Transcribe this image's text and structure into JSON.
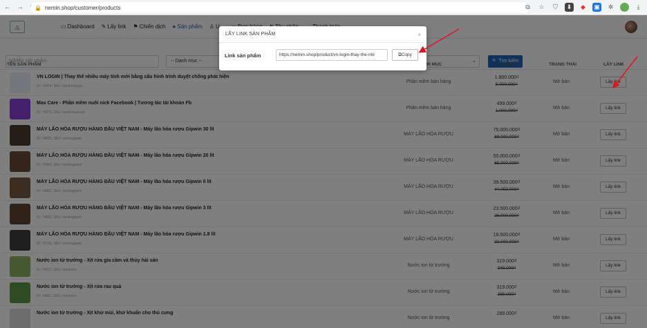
{
  "browser": {
    "url": "nemin.shop/customer/products",
    "nav_back": "←",
    "nav_forward": "→",
    "nav_reload": "C"
  },
  "header": {
    "menu": [
      {
        "label": "Dashboard",
        "icon": "▭",
        "active": false
      },
      {
        "label": "Lấy link",
        "icon": "✎",
        "active": false
      },
      {
        "label": "Chiến dịch",
        "icon": "⚑",
        "active": false
      },
      {
        "label": "Sản phẩm",
        "icon": "●",
        "active": true
      },
      {
        "label": "U...",
        "icon": "♙",
        "active": false
      },
      {
        "label": "Đơn hàng",
        "icon": "▭",
        "active": false
      },
      {
        "label": "Thu nhập",
        "icon": "↯",
        "active": false
      },
      {
        "label": "Thanh toán",
        "icon": "▬",
        "active": false
      }
    ]
  },
  "filters": {
    "search_placeholder": "Mã/tên sản phẩm",
    "category_value": "-- Danh mục --",
    "search_button": "Tìm kiếm",
    "search_icon": "🔍"
  },
  "table": {
    "headers": {
      "name": "TÊN SẢN PHẨM",
      "category": "DANH MỤC",
      "price": "GIÁ BÁN",
      "status": "TRẠNG THÁI",
      "action": "LẤY LINK"
    },
    "rows": [
      {
        "name": "VN LOGIN | Thay thế nhiều máy tính mới bằng cấu hình trình duyệt chống phát hiện",
        "meta": "ID: 74874, SKU: neminvnlogin",
        "category": "Phần mềm bán hàng",
        "price": "1.800.000₫",
        "old_price": "5.000.000₫",
        "status": "Mở bán",
        "button": "Lấy link",
        "thumb": "#e8eef7"
      },
      {
        "name": "Max Care - Phần mềm nuôi nick Facebook | Tương tác tài khoản Fb",
        "meta": "ID: 74875, SKU: neminmaxcare",
        "category": "Phần mềm bán hàng",
        "price": "499.000₫",
        "old_price": "1.000.000₫",
        "status": "Mở bán",
        "button": "Lấy link",
        "thumb": "#8a3fd6"
      },
      {
        "name": "MÁY LÃO HÓA RƯỢU HÀNG ĐẦU VIỆT NAM - Máy lão hóa rượu Gipwin 30 lít",
        "meta": "ID: 74805, SKU: nemingipwin",
        "category": "MÁY LÃO HÓA RƯỢU",
        "price": "75.000.000₫",
        "old_price": "89.000.000₫",
        "status": "Mở bán",
        "button": "Lấy link",
        "thumb": "#4a3a30"
      },
      {
        "name": "MÁY LÃO HÓA RƯỢU HÀNG ĐẦU VIỆT NAM - Máy lão hóa rượu Gipwin 20 lít",
        "meta": "ID: 74804, SKU: nemingipwin",
        "category": "MÁY LÃO HÓA RƯỢU",
        "price": "55.000.000₫",
        "old_price": "65.000.000₫",
        "status": "Mở bán",
        "button": "Lấy link",
        "thumb": "#6b4b35"
      },
      {
        "name": "MÁY LÃO HÓA RƯỢU HÀNG ĐẦU VIỆT NAM - Máy lão hóa rượu Gipwin 5 lít",
        "meta": "ID: 74801, SKU: nemingipwin",
        "category": "MÁY LÃO HÓA RƯỢU",
        "price": "38.500.000₫",
        "old_price": "44.000.000₫",
        "status": "Mở bán",
        "button": "Lấy link",
        "thumb": "#7a5a40"
      },
      {
        "name": "MÁY LÃO HÓA RƯỢU HÀNG ĐẦU VIỆT NAM - Máy lão hóa rượu Gipwin 3 lít",
        "meta": "ID: 74800, SKU: nemingipwin",
        "category": "MÁY LÃO HÓA RƯỢU",
        "price": "23.500.000₫",
        "old_price": "26.000.000₫",
        "status": "Mở bán",
        "button": "Lấy link",
        "thumb": "#5e4530"
      },
      {
        "name": "MÁY LÃO HÓA RƯỢU HÀNG ĐẦU VIỆT NAM - Máy lão hóa rượu Gipwin 1.8 lít",
        "meta": "ID: 74799, SKU: nemingipwin",
        "category": "MÁY LÃO HÓA RƯỢU",
        "price": "18.500.000₫",
        "old_price": "23.000.000₫",
        "status": "Mở bán",
        "button": "Lấy link",
        "thumb": "#3c3c3c"
      },
      {
        "name": "Nước ion từ trường - Xịt rửa gia cầm và thủy hải sản",
        "meta": "ID: 74812, SKU: neminion",
        "category": "Nước ion từ trường",
        "price": "319.000₫",
        "old_price": "349.000₫",
        "status": "Mở bán",
        "button": "Lấy link",
        "thumb": "#8ab060"
      },
      {
        "name": "Nước ion từ trường - Xịt rửa rau quả",
        "meta": "ID: 74807, SKU: neminion",
        "category": "Nước ion từ trường",
        "price": "319.000₫",
        "old_price": "389.000₫",
        "status": "Mở bán",
        "button": "Lấy link",
        "thumb": "#5c9a4a"
      },
      {
        "name": "Nước ion từ trường - Xịt khử mùi, khử khuẩn cho thú cưng",
        "meta": "",
        "category": "Nước ion từ trường",
        "price": "289.000₫",
        "old_price": "",
        "status": "Mở bán",
        "button": "Lấy link",
        "thumb": "#d9d9d9"
      }
    ]
  },
  "modal": {
    "title": "LẤY LINK SẢN PHẨM",
    "close": "×",
    "label": "Link sản phẩm",
    "link_value": "https://nemin.shop/product/vn-login-thay-the-nhi",
    "copy_button": "Copy",
    "copy_icon": "⧉"
  },
  "colors": {
    "accent": "#1f63b8",
    "annotation_arrow": "#e0141e"
  }
}
